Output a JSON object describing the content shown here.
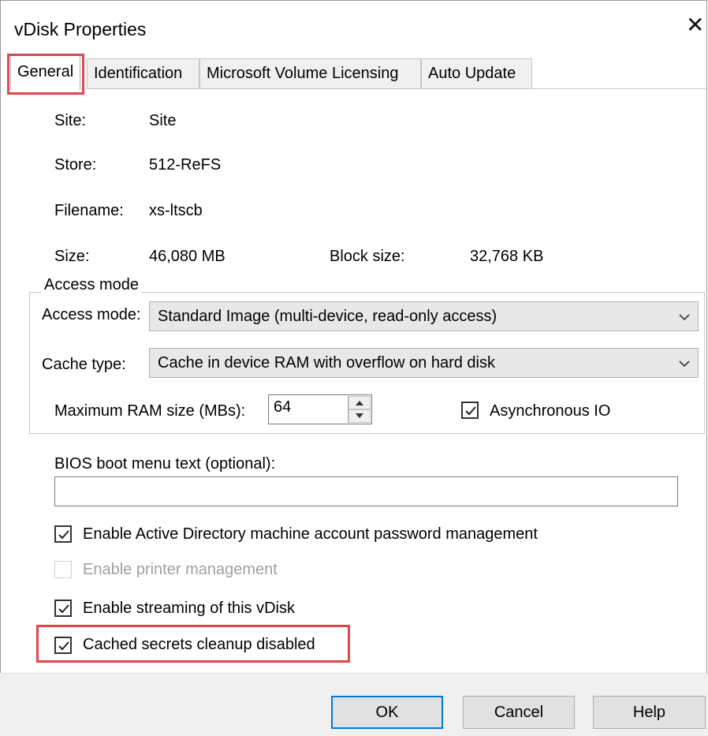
{
  "window": {
    "title": "vDisk Properties",
    "close_glyph": "✕"
  },
  "tabs": [
    {
      "label": "General"
    },
    {
      "label": "Identification"
    },
    {
      "label": "Microsoft Volume Licensing"
    },
    {
      "label": "Auto Update"
    }
  ],
  "general": {
    "site_label": "Site:",
    "site_value": "Site",
    "store_label": "Store:",
    "store_value": "512-ReFS",
    "filename_label": "Filename:",
    "filename_value": "xs-ltscb",
    "size_label": "Size:",
    "size_value": "46,080 MB",
    "block_size_label": "Block size:",
    "block_size_value": "32,768 KB"
  },
  "access_group": {
    "title": "Access mode",
    "access_mode_label": "Access mode:",
    "access_mode_value": "Standard Image (multi-device, read-only access)",
    "cache_type_label": "Cache type:",
    "cache_type_value": "Cache in device RAM with overflow on hard disk",
    "max_ram_label": "Maximum RAM size (MBs):",
    "max_ram_value": "64",
    "async_io_label": "Asynchronous IO",
    "async_io_checked": true
  },
  "bios": {
    "label": "BIOS boot menu text (optional):",
    "value": ""
  },
  "options": [
    {
      "label": "Enable Active Directory machine account password management",
      "checked": true,
      "enabled": true
    },
    {
      "label": "Enable printer management",
      "checked": false,
      "enabled": false
    },
    {
      "label": "Enable streaming of this vDisk",
      "checked": true,
      "enabled": true
    },
    {
      "label": "Cached secrets cleanup disabled",
      "checked": true,
      "enabled": true
    }
  ],
  "buttons": {
    "ok": "OK",
    "cancel": "Cancel",
    "help": "Help"
  },
  "colors": {
    "highlight": "#e0474c",
    "default_button_border": "#0078d7"
  }
}
